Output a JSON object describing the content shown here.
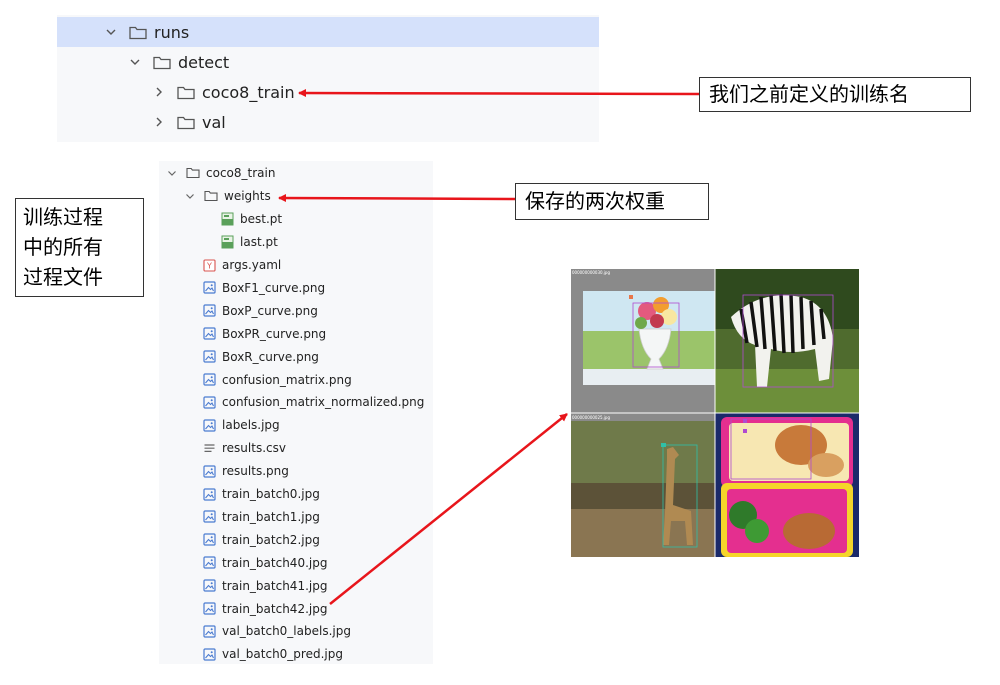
{
  "top_tree": {
    "rows": [
      {
        "label": "runs",
        "expanded": true
      },
      {
        "label": "detect",
        "expanded": true
      },
      {
        "label": "coco8_train",
        "expanded": false
      },
      {
        "label": "val",
        "expanded": false
      }
    ]
  },
  "file_tree": {
    "root": "coco8_train",
    "weights_folder": "weights",
    "weights": [
      "best.pt",
      "last.pt"
    ],
    "files": [
      {
        "name": "args.yaml",
        "icon": "yaml-icon"
      },
      {
        "name": "BoxF1_curve.png",
        "icon": "image-file-icon"
      },
      {
        "name": "BoxP_curve.png",
        "icon": "image-file-icon"
      },
      {
        "name": "BoxPR_curve.png",
        "icon": "image-file-icon"
      },
      {
        "name": "BoxR_curve.png",
        "icon": "image-file-icon"
      },
      {
        "name": "confusion_matrix.png",
        "icon": "image-file-icon"
      },
      {
        "name": "confusion_matrix_normalized.png",
        "icon": "image-file-icon"
      },
      {
        "name": "labels.jpg",
        "icon": "image-file-icon"
      },
      {
        "name": "results.csv",
        "icon": "text-file-icon"
      },
      {
        "name": "results.png",
        "icon": "image-file-icon"
      },
      {
        "name": "train_batch0.jpg",
        "icon": "image-file-icon"
      },
      {
        "name": "train_batch1.jpg",
        "icon": "image-file-icon"
      },
      {
        "name": "train_batch2.jpg",
        "icon": "image-file-icon"
      },
      {
        "name": "train_batch40.jpg",
        "icon": "image-file-icon"
      },
      {
        "name": "train_batch41.jpg",
        "icon": "image-file-icon"
      },
      {
        "name": "train_batch42.jpg",
        "icon": "image-file-icon"
      },
      {
        "name": "val_batch0_labels.jpg",
        "icon": "image-file-icon"
      },
      {
        "name": "val_batch0_pred.jpg",
        "icon": "image-file-icon"
      }
    ]
  },
  "callouts": {
    "train_name": "我们之前定义的训练名",
    "weights": "保存的两次权重",
    "process_files": [
      "训练过程",
      "中的所有",
      "过程文件"
    ]
  },
  "mosaic": {
    "tile_labels": [
      "000000000030.jpg",
      "000000000025.jpg"
    ]
  },
  "colors": {
    "selection": "#d5e1fb",
    "panel": "#f7f8fa",
    "arrow": "#e8151b",
    "image_icon": "#4a7bd0",
    "yaml_icon": "#d9534f",
    "weights_icon": "#5aa05a"
  }
}
